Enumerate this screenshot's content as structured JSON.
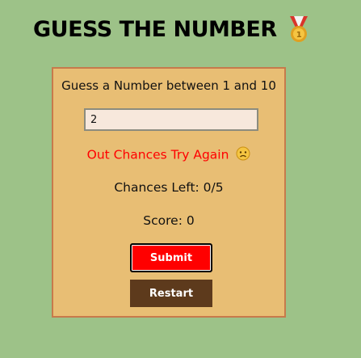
{
  "header": {
    "title": "GUESS THE NUMBER",
    "icon": "medal-icon"
  },
  "game": {
    "prompt": "Guess a Number between 1 and 10",
    "input_value": "2",
    "message": "Out Chances Try Again",
    "message_icon": "sad-face-icon",
    "chances_label": "Chances Left: 0/5",
    "score_label": "Score: 0",
    "submit_label": "Submit",
    "restart_label": "Restart"
  },
  "colors": {
    "background": "#9dc288",
    "card": "#e8be74",
    "card_border": "#c77a4b",
    "message": "#ff0000",
    "submit": "#ff0000",
    "restart": "#5d3a1c"
  }
}
